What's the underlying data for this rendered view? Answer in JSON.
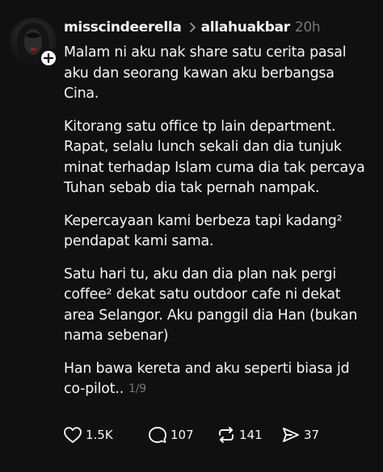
{
  "post": {
    "username": "misscindeerella",
    "community": "allahuakbar",
    "time": "20h",
    "paragraphs": [
      "Malam ni aku nak share satu cerita pasal\naku dan seorang kawan aku berbangsa\nCina.",
      "Kitorang satu office tp lain department.\nRapat, selalu lunch sekali dan dia tunjuk\nminat terhadap Islam cuma dia tak percaya\nTuhan sebab dia tak pernah nampak.",
      "Kepercayaan kami berbeza tapi kadang²\npendapat kami sama.",
      "Satu hari tu, aku dan dia plan nak pergi\ncoffee² dekat satu outdoor cafe ni dekat\narea Selangor. Aku panggil dia Han (bukan\nnama sebenar)",
      "Han bawa kereta and aku seperti biasa jd\nco-pilot.."
    ],
    "page_indicator": "1/9"
  },
  "actions": {
    "likes": "1.5K",
    "replies": "107",
    "reposts": "141",
    "shares": "37"
  },
  "icons": {
    "avatar": "avatar-photo",
    "follow": "plus-icon",
    "separator": "chevron-right-icon",
    "like": "heart-icon",
    "reply": "comment-bubble-icon",
    "repost": "repost-icon",
    "share": "send-icon"
  },
  "colors": {
    "background": "#101010",
    "text": "#f3f5f7",
    "muted": "#777777"
  }
}
